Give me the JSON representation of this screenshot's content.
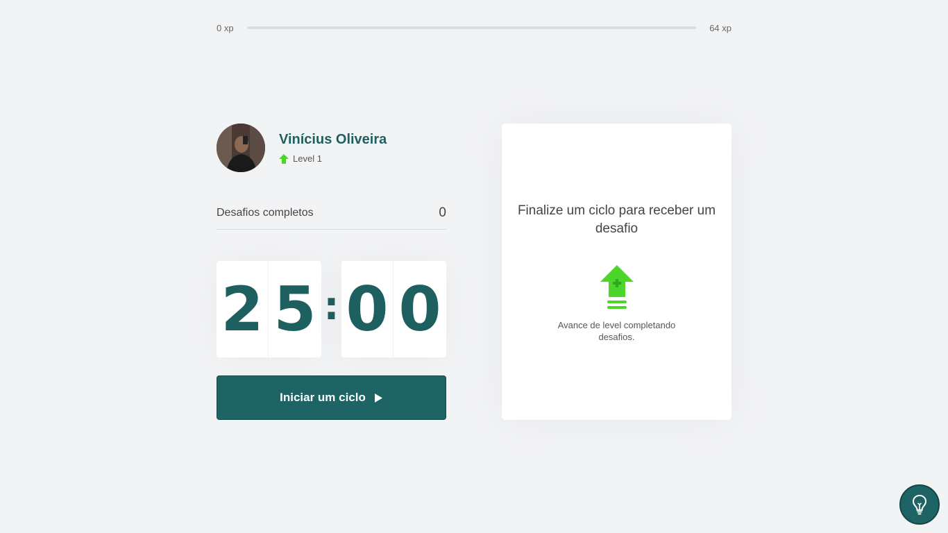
{
  "xp": {
    "min_label": "0 xp",
    "max_label": "64 xp",
    "progress": 0
  },
  "profile": {
    "name": "Vinícius Oliveira",
    "level": "Level 1"
  },
  "challenges": {
    "label": "Desafios completos",
    "value": "0"
  },
  "countdown": {
    "minute_left": "2",
    "minute_right": "5",
    "separator": ":",
    "second_left": "0",
    "second_right": "0"
  },
  "start_button": {
    "label": "Iniciar um ciclo"
  },
  "challenge_card": {
    "title": "Finalize um ciclo para receber um desafio",
    "text": "Avance de level completando desafios."
  },
  "icons": {
    "level": "level-up-arrow-icon",
    "play": "play-icon",
    "card": "level-up-icon",
    "hint": "lightbulb-icon"
  },
  "colors": {
    "primary": "#1e6464",
    "accent_green": "#4cd62b",
    "background": "#f2f3f5"
  }
}
